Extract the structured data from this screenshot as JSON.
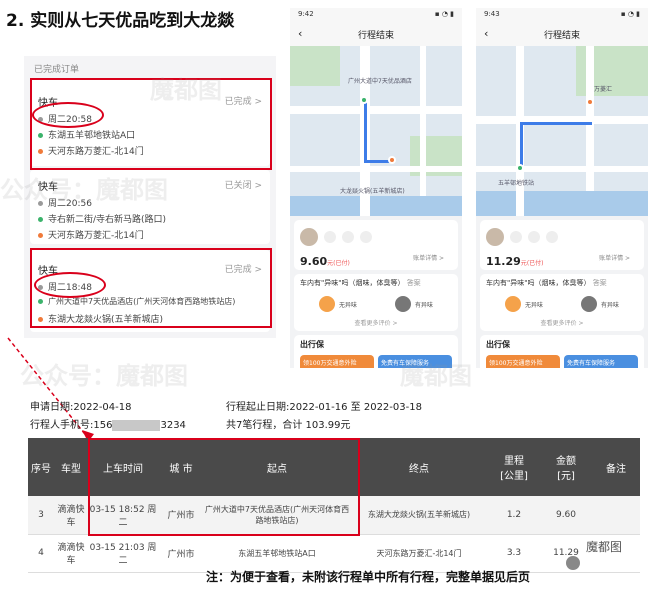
{
  "title": "2. 实则从七天优品吃到大龙燚",
  "orders": {
    "header": "已完成订单",
    "cards": [
      {
        "type": "快车",
        "status": "已完成 >",
        "time": "周二20:58",
        "from": "东湖五羊邨地铁站A口",
        "to": "天河东路万菱汇-北14门"
      },
      {
        "type": "快车",
        "status": "已关闭 >",
        "time": "周二20:56",
        "from": "寺右新二街/寺右新马路(路口)",
        "to": "天河东路万菱汇-北14门"
      },
      {
        "type": "快车",
        "status": "已完成 >",
        "time": "周二18:48",
        "from": "广州大道中7天优品酒店(广州天河体育西路地铁站店)",
        "to": "东湖大龙燚火锅(五羊新城店)"
      }
    ]
  },
  "phones": [
    {
      "time": "9:42",
      "nav_title": "行程结束",
      "price": "9.60",
      "price_unit": "元",
      "price_note": "(已付)",
      "detail": "账单详情 >",
      "question": "车内有\"异味\"吗（烟味，体臭等）",
      "ask": "答案",
      "btn_no": "无异味",
      "btn_yes": "有异味",
      "tips": "查看更多评价 >",
      "insurance": "出行保",
      "promo1": "领100万交通意外险",
      "promo2": "免费有车保障服务"
    },
    {
      "time": "9:43",
      "nav_title": "行程结束",
      "price": "11.29",
      "price_unit": "元",
      "price_note": "(已付)",
      "detail": "账单详情 >",
      "question": "车内有\"异味\"吗（烟味，体臭等）",
      "ask": "答案",
      "btn_no": "无异味",
      "btn_yes": "有异味",
      "tips": "查看更多评价 >",
      "insurance": "出行保",
      "promo1": "领100万交通意外险",
      "promo2": "免费有车保障服务"
    }
  ],
  "map_labels": [
    "广州大道中7天优品酒店",
    "大龙燚火锅(五羊新城店)",
    "五羊邨地铁站",
    "万菱汇"
  ],
  "info": {
    "apply_date": "申请日期:2022-04-18",
    "trip_range": "行程起止日期:2022-01-16 至 2022-03-18",
    "phone_prefix": "行程人手机号:156",
    "phone_suffix": "3234",
    "summary": "共7笔行程，合计 103.99元"
  },
  "table": {
    "headers": [
      "序号",
      "车型",
      "上车时间",
      "城 市",
      "起点",
      "终点",
      "里程\n[公里]",
      "金额\n[元]",
      "备注"
    ],
    "rows": [
      [
        "3",
        "滴滴快车",
        "03-15 18:52 周二",
        "广州市",
        "广州大道中7天优品酒店(广州天河体育西路地铁站店)",
        "东湖大龙燚火锅(五羊新城店)",
        "1.2",
        "9.60",
        ""
      ],
      [
        "4",
        "滴滴快车",
        "03-15 21:03 周二",
        "广州市",
        "东湖五羊邨地铁站A口",
        "天河东路万菱汇-北14门",
        "3.3",
        "11.29",
        ""
      ]
    ]
  },
  "watermarks": [
    "魔都图",
    "公众号：魔都图",
    "公众号：魔都图",
    "魔都图"
  ],
  "logo": "魔都图",
  "footer_note": "注：为便于查看，未附该行程单中所有行程，完整单据见后页"
}
